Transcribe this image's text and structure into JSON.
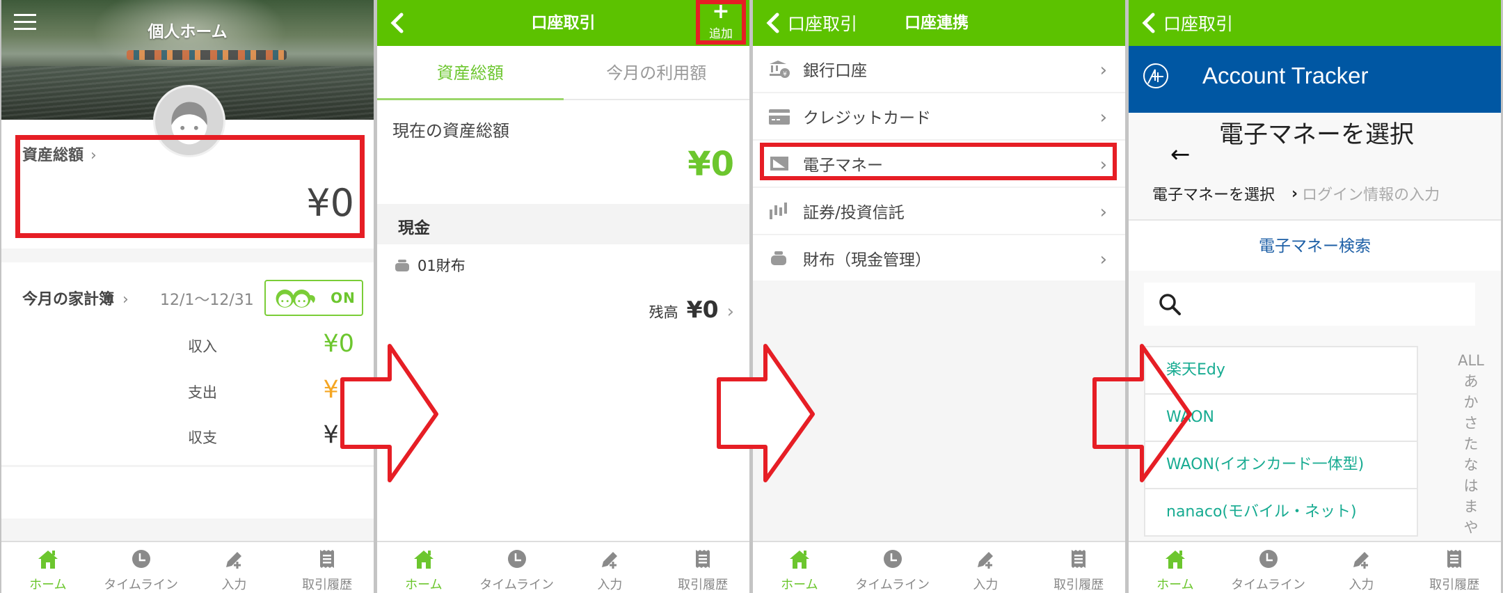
{
  "colors": {
    "brand_green": "#5cc200",
    "accent_green": "#6cc62e",
    "expense_orange": "#f5a623",
    "highlight_red": "#e61e25",
    "account_tracker_blue": "#0057a3",
    "list_teal": "#17ab91",
    "link_blue": "#1d5fa6"
  },
  "bottom_nav": [
    {
      "label": "ホーム",
      "icon": "home-icon",
      "active": true
    },
    {
      "label": "タイムライン",
      "icon": "clock-icon",
      "active": false
    },
    {
      "label": "入力",
      "icon": "pen-plus-icon",
      "active": false
    },
    {
      "label": "取引履歴",
      "icon": "receipt-icon",
      "active": false
    }
  ],
  "panel1": {
    "title": "個人ホーム",
    "menu_icon": "hamburger-icon",
    "asset_total_label": "資産総額",
    "asset_total_chevron": "›",
    "asset_total_amount": "¥0",
    "household_title": "今月の家計簿",
    "household_chevron": "›",
    "household_period": "12/1〜12/31",
    "share_badge": "ON",
    "rows": [
      {
        "label": "収入",
        "value": "¥0",
        "color": "#6cc62e"
      },
      {
        "label": "支出",
        "value": "¥0",
        "color": "#f5a623"
      },
      {
        "label": "収支",
        "value": "¥0",
        "color": "#333333"
      }
    ]
  },
  "panel2": {
    "title": "口座取引",
    "add_label": "追加",
    "add_icon": "+",
    "tabs": [
      {
        "label": "資産総額",
        "active": true
      },
      {
        "label": "今月の利用額",
        "active": false
      }
    ],
    "current_total_label": "現在の資産総額",
    "current_total_amount": "¥0",
    "section_title": "現金",
    "wallet_name": "01財布",
    "balance_label": "残高",
    "balance_amount": "¥0",
    "balance_chevron": "›"
  },
  "panel3": {
    "back_label": "口座取引",
    "title": "口座連携",
    "items": [
      {
        "label": "銀行口座",
        "icon": "bank-icon"
      },
      {
        "label": "クレジットカード",
        "icon": "credit-card-icon"
      },
      {
        "label": "電子マネー",
        "icon": "e-money-icon",
        "highlighted": true
      },
      {
        "label": "証券/投資信託",
        "icon": "chart-bars-icon"
      },
      {
        "label": "財布（現金管理）",
        "icon": "wallet-icon"
      }
    ],
    "chevron": "›"
  },
  "panel4": {
    "back_label": "口座取引",
    "tracker_title": "Account Tracker",
    "select_title": "電子マネーを選択",
    "back_arrow": "←",
    "breadcrumb": {
      "current": "電子マネーを選択",
      "separator": "›",
      "next": "ログイン情報の入力"
    },
    "search_label": "電子マネー検索",
    "search_value": "",
    "search_placeholder": "",
    "list": [
      "楽天Edy",
      "WAON",
      "WAON(イオンカード一体型)",
      "nanaco(モバイル・ネット)"
    ],
    "index": [
      "ALL",
      "あ",
      "か",
      "さ",
      "た",
      "な",
      "は",
      "ま",
      "や"
    ]
  }
}
